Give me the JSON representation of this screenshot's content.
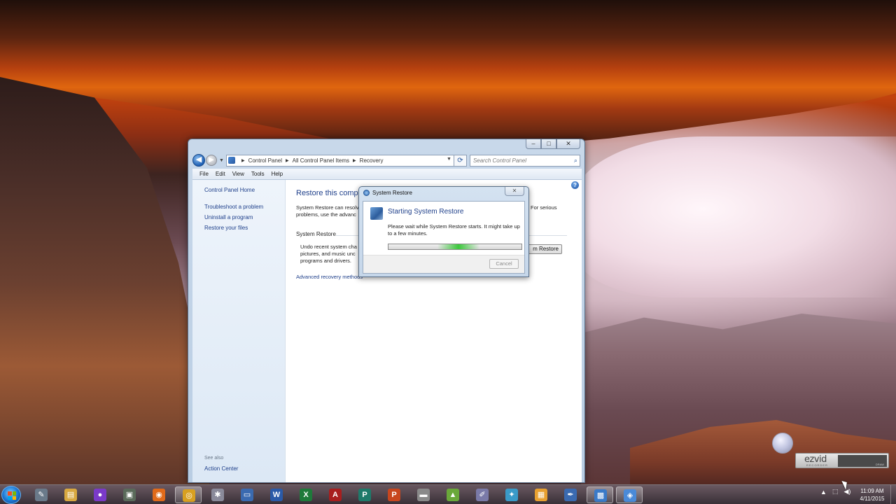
{
  "window": {
    "title_buttons": [
      "–",
      "□",
      "✕"
    ],
    "breadcrumb": [
      "Control Panel",
      "All Control Panel Items",
      "Recovery"
    ],
    "search_placeholder": "Search Control Panel",
    "menu": [
      "File",
      "Edit",
      "View",
      "Tools",
      "Help"
    ],
    "left_pane": {
      "home": "Control Panel Home",
      "links": [
        "Troubleshoot a problem",
        "Uninstall a program",
        "Restore your files"
      ],
      "see_also": "See also",
      "see_also_links": [
        "Action Center"
      ]
    },
    "main": {
      "title": "Restore this comput",
      "desc": "System Restore can resolv problems, use the advanc",
      "desc_right": "For serious",
      "section": "System Restore",
      "section_desc": "Undo recent system cha pictures, and music unc programs and drivers.",
      "open_button": "m Restore",
      "advanced_link": "Advanced recovery methods"
    }
  },
  "dialog": {
    "title": "System Restore",
    "heading": "Starting System Restore",
    "message": "Please wait while System Restore starts. It might take up to a few minutes.",
    "progress_state": "indeterminate",
    "cancel_label": "Cancel"
  },
  "ezvid": {
    "logo": "ezvid",
    "sub": "RECORDER",
    "draw": "DRAW"
  },
  "taskbar": {
    "icons": [
      {
        "name": "pen-tool-icon",
        "glyph": "✎",
        "color": "#6a7a8a"
      },
      {
        "name": "folder-icon",
        "glyph": "▤",
        "color": "#d8a840"
      },
      {
        "name": "media-icon",
        "glyph": "●",
        "color": "#7a3ac8"
      },
      {
        "name": "scanner-icon",
        "glyph": "▣",
        "color": "#5a6a5a"
      },
      {
        "name": "firefox-icon",
        "glyph": "◉",
        "color": "#e06a1a"
      },
      {
        "name": "chrome-icon",
        "glyph": "◎",
        "color": "#d8a020"
      },
      {
        "name": "network-icon",
        "glyph": "✱",
        "color": "#8a8a9a"
      },
      {
        "name": "monitor-icon",
        "glyph": "▭",
        "color": "#3a6ab0"
      },
      {
        "name": "word-icon",
        "glyph": "W",
        "color": "#2a5aa8"
      },
      {
        "name": "excel-icon",
        "glyph": "X",
        "color": "#1e7a3a"
      },
      {
        "name": "access-icon",
        "glyph": "A",
        "color": "#a81e1e"
      },
      {
        "name": "publisher-icon",
        "glyph": "P",
        "color": "#1e7a6a"
      },
      {
        "name": "powerpoint-icon",
        "glyph": "P",
        "color": "#c8461e"
      },
      {
        "name": "drive-icon",
        "glyph": "▬",
        "color": "#8a8a8a"
      },
      {
        "name": "android-icon",
        "glyph": "▲",
        "color": "#6aa83a"
      },
      {
        "name": "editor-icon",
        "glyph": "✐",
        "color": "#7a7aa8"
      },
      {
        "name": "app-icon",
        "glyph": "✦",
        "color": "#3a9ac8"
      },
      {
        "name": "grid-icon",
        "glyph": "▦",
        "color": "#e8a030"
      },
      {
        "name": "pen-icon",
        "glyph": "✒",
        "color": "#3a6ab0"
      },
      {
        "name": "control-panel-icon",
        "glyph": "▩",
        "color": "#3a7ac8"
      },
      {
        "name": "system-restore-icon",
        "glyph": "◈",
        "color": "#4a8ad8"
      }
    ],
    "active_indices": [
      5,
      19,
      20
    ],
    "tray_icons": [
      "▲",
      "⬚",
      "◀)"
    ],
    "time": "11:09 AM",
    "date": "4/11/2015"
  }
}
